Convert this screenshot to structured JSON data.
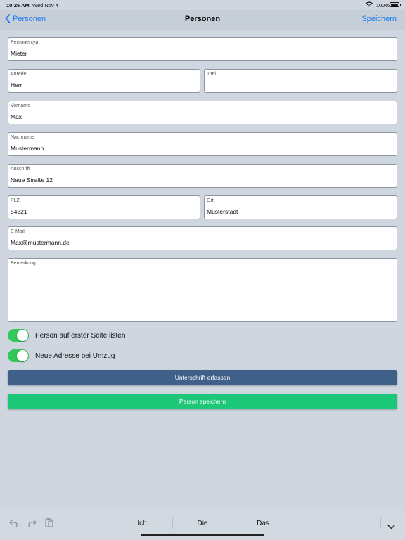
{
  "status_bar": {
    "time": "10:25 AM",
    "date": "Wed Nov 4",
    "battery": "100%"
  },
  "nav": {
    "back_label": "Personen",
    "title": "Personen",
    "save_label": "Speichern"
  },
  "form": {
    "personentyp": {
      "label": "Personentyp",
      "value": "Mieter"
    },
    "anrede": {
      "label": "Anrede",
      "value": "Herr"
    },
    "titel": {
      "label": "Titel",
      "value": ""
    },
    "vorname": {
      "label": "Vorname",
      "value": "Max"
    },
    "nachname": {
      "label": "Nachname",
      "value": "Mustermann"
    },
    "anschrift": {
      "label": "Anschrift",
      "value": "Neue Straße 12"
    },
    "plz": {
      "label": "PLZ",
      "value": "54321"
    },
    "ort": {
      "label": "Ort",
      "value": "Musterstadt"
    },
    "email": {
      "label": "E-Mail",
      "value": "Max@mustermann.de"
    },
    "bemerkung": {
      "label": "Bemerkung",
      "value": ""
    }
  },
  "toggles": [
    {
      "label": "Person auf erster Seite listen",
      "on": true
    },
    {
      "label": "Neue Adresse bei Umzug",
      "on": true
    }
  ],
  "buttons": {
    "signature": "Unterschrift erfassen",
    "save": "Person speichern"
  },
  "keyboard": {
    "suggestions": [
      "Ich",
      "Die",
      "Das"
    ]
  },
  "colors": {
    "accent": "#1a7cf2",
    "toggle_on": "#34c759",
    "signature_button": "#3f6189",
    "save_button": "#1cc778",
    "background": "#cfd6e0"
  }
}
